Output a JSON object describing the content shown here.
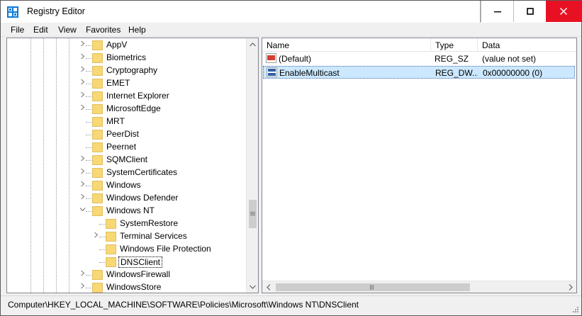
{
  "window": {
    "title": "Registry Editor",
    "close_color": "#e81123"
  },
  "menu": {
    "file": "File",
    "edit": "Edit",
    "view": "View",
    "favorites": "Favorites",
    "help": "Help"
  },
  "tree": {
    "items": [
      {
        "label": "AppV",
        "expander": ">",
        "level": 1
      },
      {
        "label": "Biometrics",
        "expander": ">",
        "level": 1
      },
      {
        "label": "Cryptography",
        "expander": ">",
        "level": 1
      },
      {
        "label": "EMET",
        "expander": ">",
        "level": 1
      },
      {
        "label": "Internet Explorer",
        "expander": ">",
        "level": 1
      },
      {
        "label": "MicrosoftEdge",
        "expander": ">",
        "level": 1
      },
      {
        "label": "MRT",
        "expander": "",
        "level": 1
      },
      {
        "label": "PeerDist",
        "expander": "",
        "level": 1
      },
      {
        "label": "Peernet",
        "expander": "",
        "level": 1
      },
      {
        "label": "SQMClient",
        "expander": ">",
        "level": 1
      },
      {
        "label": "SystemCertificates",
        "expander": ">",
        "level": 1
      },
      {
        "label": "Windows",
        "expander": ">",
        "level": 1
      },
      {
        "label": "Windows Defender",
        "expander": ">",
        "level": 1
      },
      {
        "label": "Windows NT",
        "expander": "v",
        "level": 1
      },
      {
        "label": "SystemRestore",
        "expander": "",
        "level": 2
      },
      {
        "label": "Terminal Services",
        "expander": ">",
        "level": 2
      },
      {
        "label": "Windows File Protection",
        "expander": "",
        "level": 2
      },
      {
        "label": "DNSClient",
        "expander": "",
        "level": 2,
        "selected": true
      },
      {
        "label": "WindowsFirewall",
        "expander": ">",
        "level": 1
      },
      {
        "label": "WindowsStore",
        "expander": ">",
        "level": 1
      }
    ]
  },
  "list": {
    "columns": {
      "name": "Name",
      "type": "Type",
      "data": "Data"
    },
    "rows": [
      {
        "icon": "string-value-icon",
        "name": "(Default)",
        "type": "REG_SZ",
        "data": "(value not set)",
        "selected": false
      },
      {
        "icon": "dword-value-icon",
        "name": "EnableMulticast",
        "type": "REG_DW...",
        "data": "0x00000000 (0)",
        "selected": true
      }
    ]
  },
  "status": {
    "path": "Computer\\HKEY_LOCAL_MACHINE\\SOFTWARE\\Policies\\Microsoft\\Windows NT\\DNSClient"
  },
  "colors": {
    "folder": "#f8d775",
    "folder_edge": "#d9b54a",
    "selection": "#cce8ff"
  }
}
